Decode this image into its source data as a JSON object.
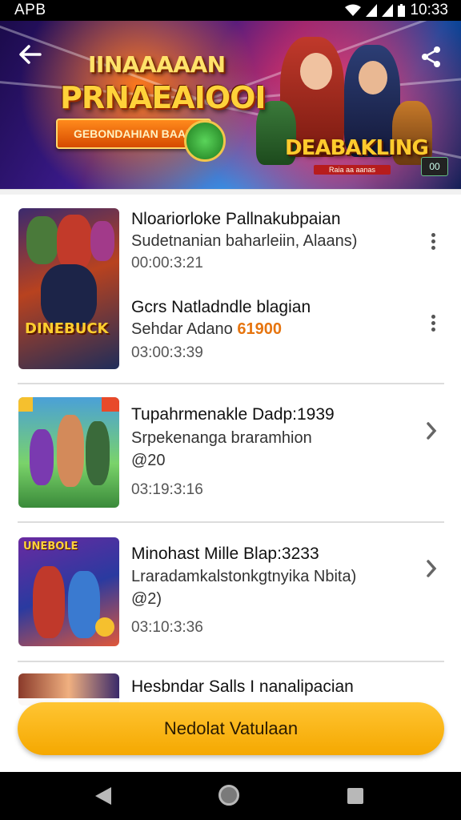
{
  "status_bar": {
    "carrier": "APB",
    "time": "10:33",
    "icons": [
      "wifi-icon",
      "signal-icon",
      "signal-icon",
      "battery-icon"
    ]
  },
  "header": {
    "back_icon": "arrow-left-icon",
    "share_icon": "share-icon",
    "banner": {
      "title_top": "IINAAAAAN",
      "title_main": "PRNAEAIOOI",
      "ribbon": "GEBONDAHIAN BAAN",
      "logo": "DEABAKLING",
      "logo_sub": "Raia aa aanas",
      "badge": "00"
    }
  },
  "items": [
    {
      "title": "Nloariorloke Pallnakubpaian",
      "subtitle": "Sudetnanian baharleiin, Alaans)",
      "time": "00:00:3:21",
      "menu": "kebab-icon"
    },
    {
      "title": "Gcrs Natladndle blagian",
      "subtitle": "Sehdar Adano",
      "subtitle_accent": "61900",
      "time": "03:00:3:39",
      "menu": "kebab-icon"
    },
    {
      "title": "Tupahrmenakle Dadp:1939",
      "subtitle": "Srpekenanga braramhion",
      "extra": "@20",
      "time": "03:19:3:16",
      "menu": "chevron-right-icon"
    },
    {
      "title": "Minohast Mille Blap:3233",
      "subtitle": "Lraradamkalstonkgtnyika Nbita)",
      "extra": "@2)",
      "time": "03:10:3:36",
      "menu": "chevron-right-icon"
    },
    {
      "title": "Hesbndar Salls I nanalipacian"
    }
  ],
  "cta": {
    "label": "Nedolat Vatulaan"
  },
  "nav": {
    "back": "back-triangle-icon",
    "home": "home-circle-icon",
    "recent": "recent-square-icon"
  },
  "colors": {
    "accent": "#f5a800",
    "banner_title": "#ffd23a",
    "highlight_text": "#e67510"
  }
}
